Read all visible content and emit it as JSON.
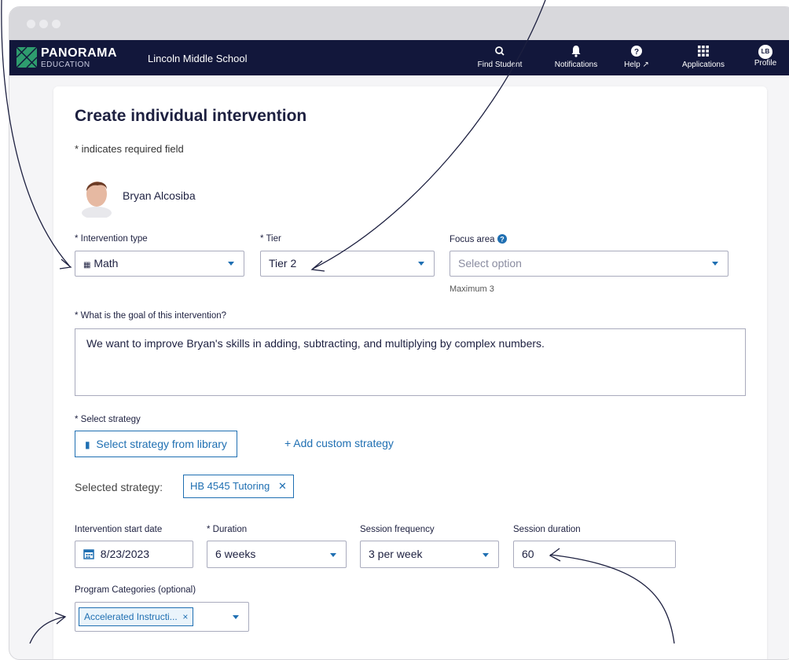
{
  "header": {
    "brand": "PANORAMA",
    "brand_sub": "EDUCATION",
    "school": "Lincoln Middle School",
    "nav": [
      {
        "label": "Find Student",
        "icon": "search-icon"
      },
      {
        "label": "Notifications",
        "icon": "bell-icon"
      },
      {
        "label": "Help",
        "icon": "help-icon"
      },
      {
        "label": "Applications",
        "icon": "grid-icon"
      },
      {
        "label": "Profile",
        "icon": "avatar"
      }
    ],
    "profile_initials": "LB"
  },
  "form": {
    "title": "Create individual intervention",
    "required_note": "* indicates required field",
    "student_name": "Bryan Alcosiba",
    "intervention_type": {
      "label": "* Intervention type",
      "value": "Math"
    },
    "tier": {
      "label": "* Tier",
      "value": "Tier 2"
    },
    "focus_area": {
      "label": "Focus area",
      "placeholder": "Select option",
      "hint": "Maximum 3"
    },
    "goal": {
      "label": "* What is the goal of this intervention?",
      "value": "We want to improve Bryan's skills in adding, subtracting, and multiplying by complex numbers."
    },
    "strategy": {
      "label": "* Select strategy",
      "library_button": "Select strategy from library",
      "custom_link": "+ Add custom strategy",
      "selected_label": "Selected strategy:",
      "selected_value": "HB 4545 Tutoring",
      "remove": "✕"
    },
    "start_date": {
      "label": "Intervention start date",
      "value": "8/23/2023"
    },
    "duration": {
      "label": "* Duration",
      "value": "6 weeks"
    },
    "session_frequency": {
      "label": "Session frequency",
      "value": "3 per week"
    },
    "session_duration": {
      "label": "Session duration",
      "value": "60"
    },
    "program_categories": {
      "label": "Program Categories (optional)",
      "chip": "Accelerated Instructi...",
      "remove": "×"
    }
  },
  "colors": {
    "navbar": "#12173b",
    "accent": "#1f6fb2",
    "chip_bg": "#eaf4fb"
  }
}
